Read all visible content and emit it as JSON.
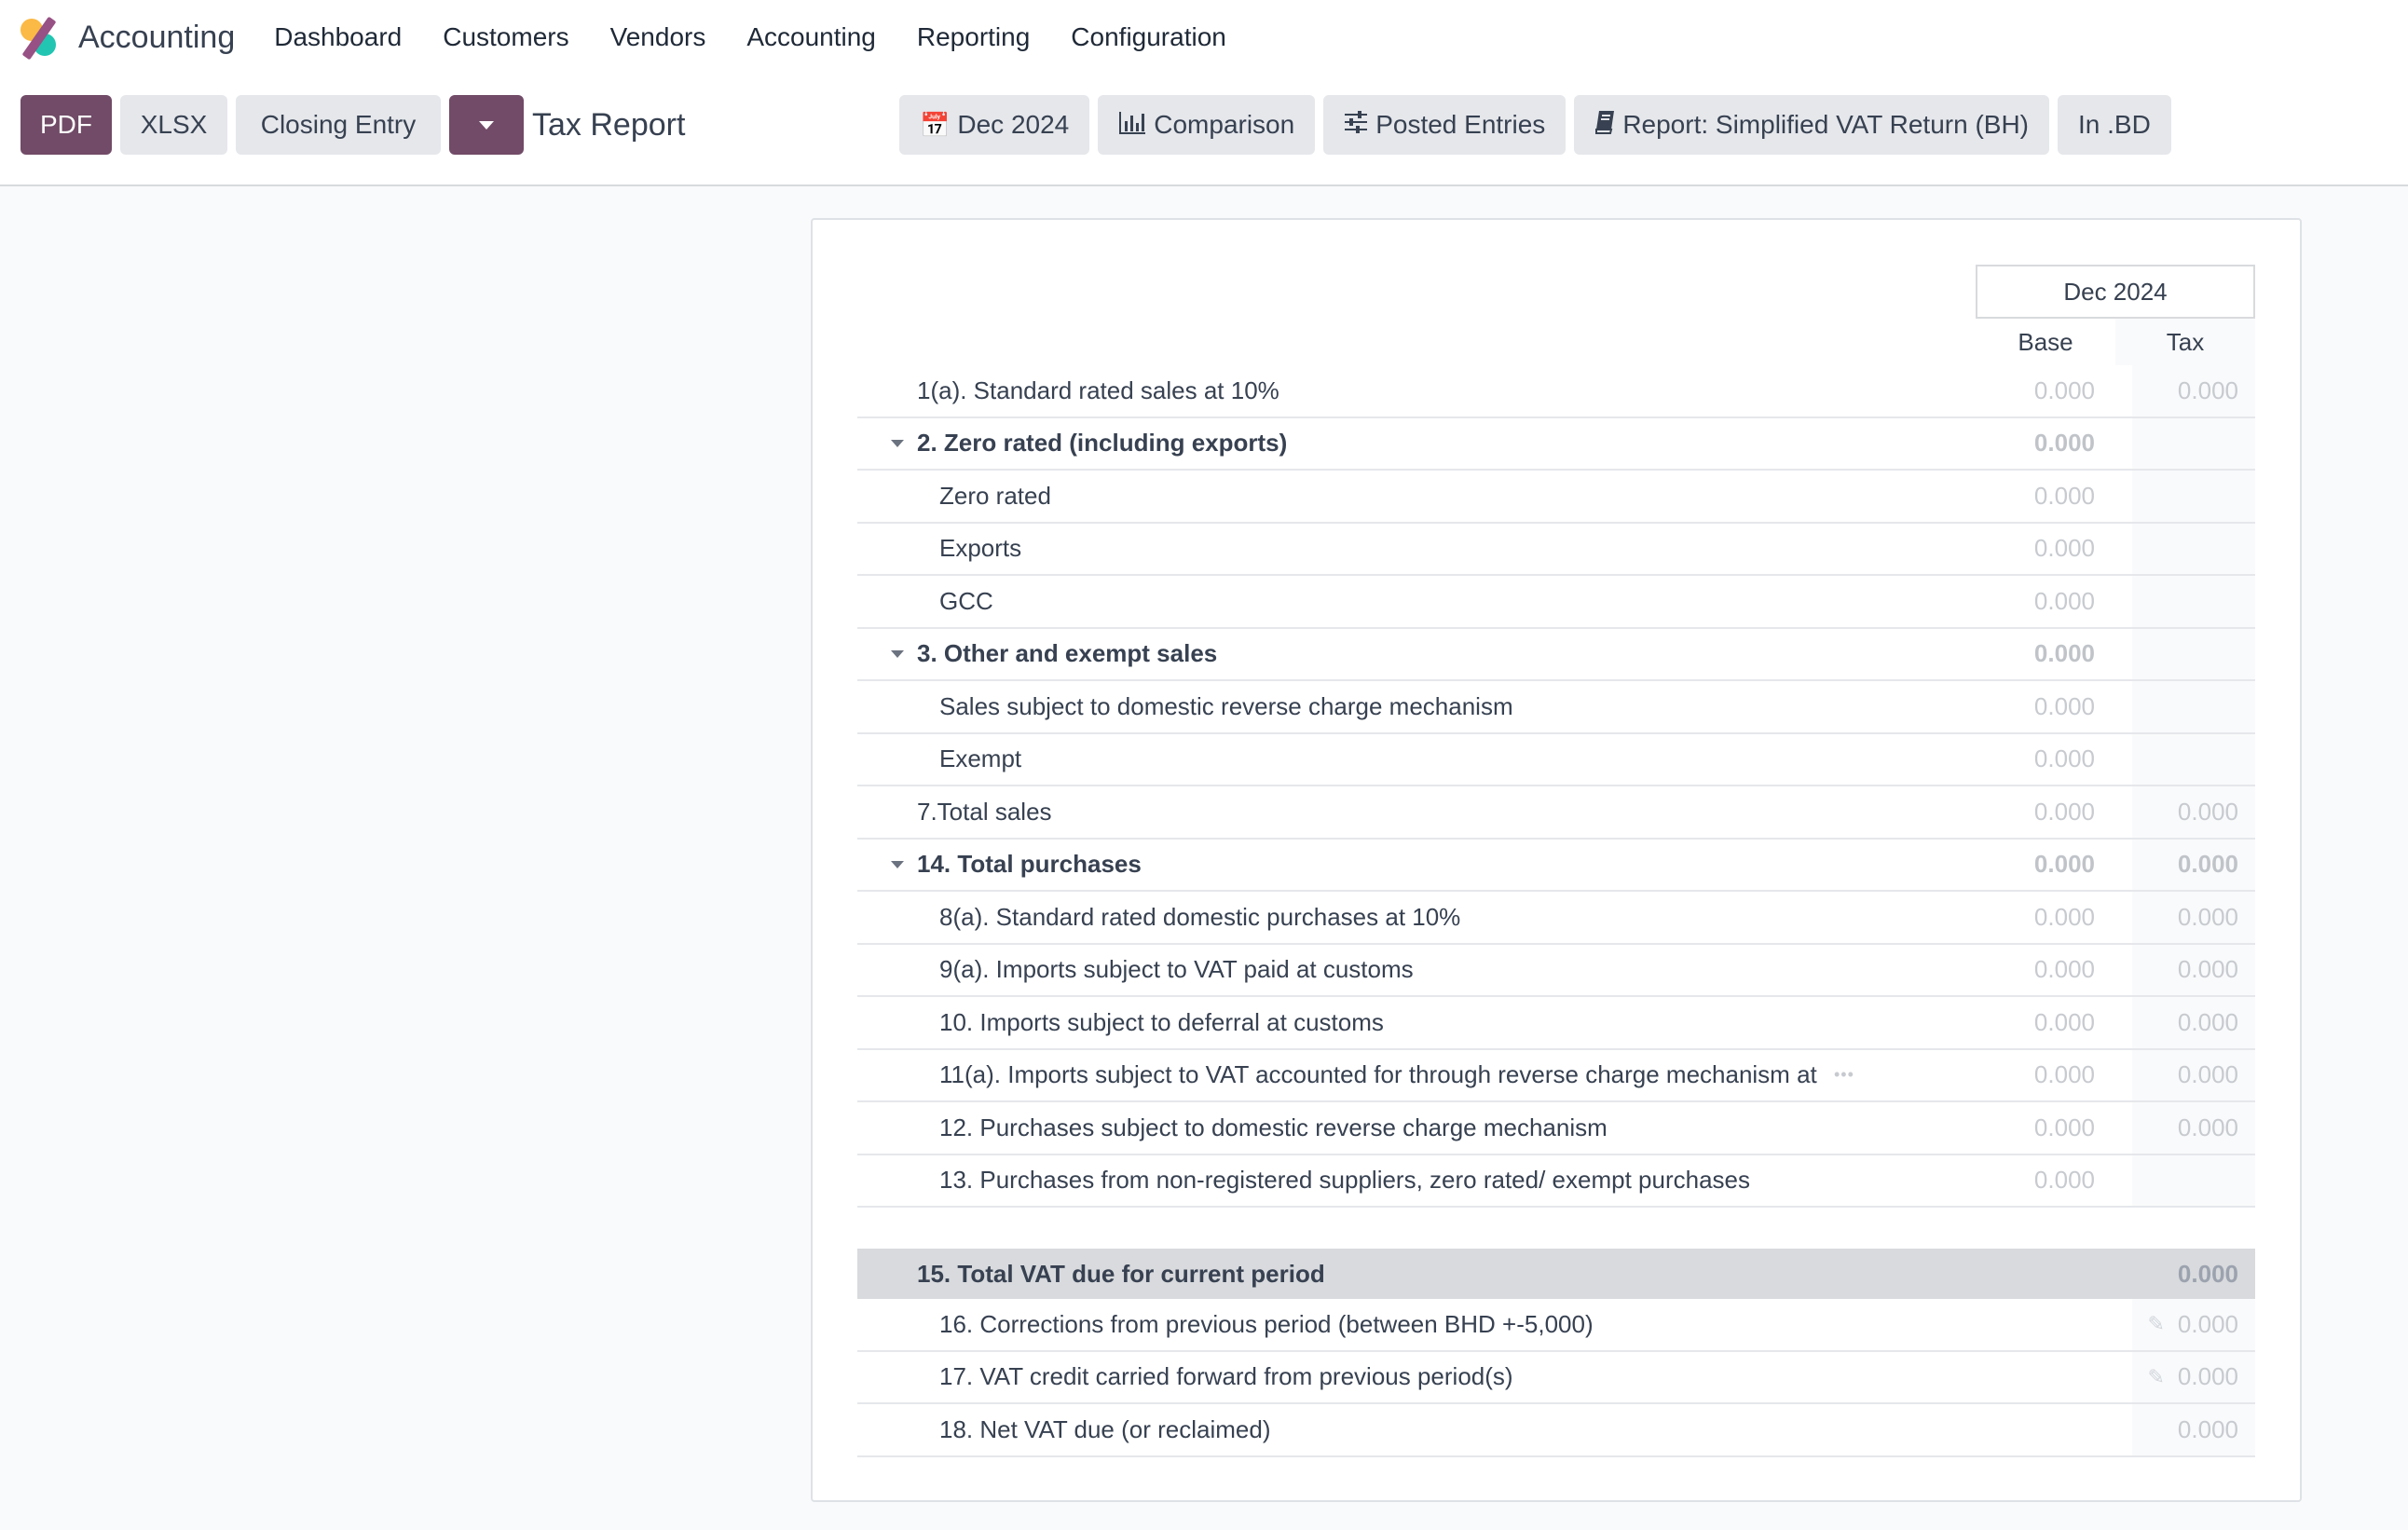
{
  "app": {
    "title": "Accounting",
    "menu": [
      "Dashboard",
      "Customers",
      "Vendors",
      "Accounting",
      "Reporting",
      "Configuration"
    ]
  },
  "toolbar": {
    "pdf_label": "PDF",
    "xlsx_label": "XLSX",
    "closing_entry_label": "Closing Entry",
    "report_title": "Tax Report",
    "filters": {
      "date": "Dec 2024",
      "comparison": "Comparison",
      "posted_entries": "Posted Entries",
      "report": "Report: Simplified VAT Return (BH)",
      "currency": "In .BD"
    }
  },
  "colors": {
    "primary": "#714b67",
    "secondary_button": "#e5e7eb",
    "total_row_bg": "#d8dadd"
  },
  "table": {
    "period": "Dec 2024",
    "columns": [
      "Base",
      "Tax"
    ],
    "rows": [
      {
        "label": "1(a). Standard rated sales at 10%",
        "base": "0.000",
        "tax": "0.000",
        "level": 0,
        "bold": false,
        "foldable": false
      },
      {
        "label": "2. Zero rated (including exports)",
        "base": "0.000",
        "tax": "",
        "level": 0,
        "bold": true,
        "foldable": true
      },
      {
        "label": "Zero rated",
        "base": "0.000",
        "tax": "",
        "level": 1,
        "bold": false,
        "foldable": false
      },
      {
        "label": "Exports",
        "base": "0.000",
        "tax": "",
        "level": 1,
        "bold": false,
        "foldable": false
      },
      {
        "label": "GCC",
        "base": "0.000",
        "tax": "",
        "level": 1,
        "bold": false,
        "foldable": false
      },
      {
        "label": "3. Other and exempt sales",
        "base": "0.000",
        "tax": "",
        "level": 0,
        "bold": true,
        "foldable": true
      },
      {
        "label": "Sales subject to domestic reverse charge mechanism",
        "base": "0.000",
        "tax": "",
        "level": 1,
        "bold": false,
        "foldable": false
      },
      {
        "label": "Exempt",
        "base": "0.000",
        "tax": "",
        "level": 1,
        "bold": false,
        "foldable": false
      },
      {
        "label": "7.Total sales",
        "base": "0.000",
        "tax": "0.000",
        "level": 0,
        "bold": false,
        "foldable": false
      },
      {
        "label": "14. Total purchases",
        "base": "0.000",
        "tax": "0.000",
        "level": 0,
        "bold": true,
        "foldable": true
      },
      {
        "label": "8(a). Standard rated domestic purchases at 10%",
        "base": "0.000",
        "tax": "0.000",
        "level": 1,
        "bold": false,
        "foldable": false
      },
      {
        "label": "9(a). Imports subject to VAT paid at customs",
        "base": "0.000",
        "tax": "0.000",
        "level": 1,
        "bold": false,
        "foldable": false
      },
      {
        "label": "10. Imports subject to deferral at customs",
        "base": "0.000",
        "tax": "0.000",
        "level": 1,
        "bold": false,
        "foldable": false
      },
      {
        "label": "11(a). Imports subject to VAT accounted for through reverse charge mechanism at",
        "base": "0.000",
        "tax": "0.000",
        "level": 1,
        "bold": false,
        "foldable": false,
        "truncated": true
      },
      {
        "label": "12. Purchases subject to domestic reverse charge mechanism",
        "base": "0.000",
        "tax": "0.000",
        "level": 1,
        "bold": false,
        "foldable": false
      },
      {
        "label": "13. Purchases from non-registered suppliers, zero rated/ exempt purchases",
        "base": "0.000",
        "tax": "",
        "level": 1,
        "bold": false,
        "foldable": false
      }
    ],
    "total": {
      "label": "15. Total VAT due for current period",
      "tax": "0.000"
    },
    "after_total": [
      {
        "label": "16. Corrections from previous period (between BHD +-5,000)",
        "tax": "0.000",
        "editable": true
      },
      {
        "label": "17. VAT credit carried forward from previous period(s)",
        "tax": "0.000",
        "editable": true
      },
      {
        "label": "18. Net VAT due (or reclaimed)",
        "tax": "0.000",
        "editable": false
      }
    ]
  }
}
